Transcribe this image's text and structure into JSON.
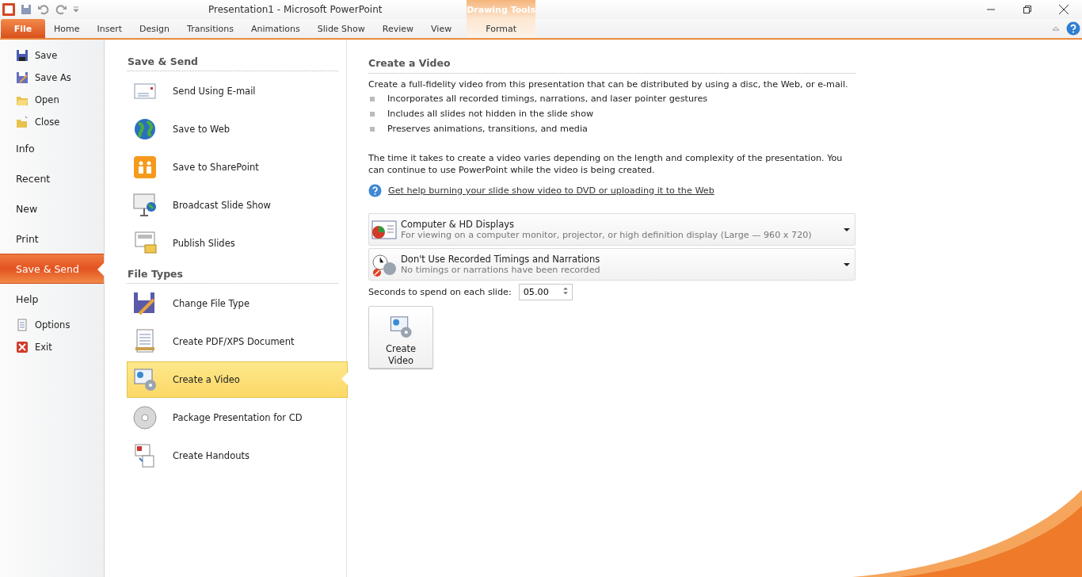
{
  "window": {
    "title": "Presentation1  -  Microsoft PowerPoint"
  },
  "ribbon_tabs": [
    {
      "label": "File",
      "selected": true
    },
    {
      "label": "Home",
      "selected": false
    },
    {
      "label": "Insert",
      "selected": false
    },
    {
      "label": "Design",
      "selected": false
    },
    {
      "label": "Transitions",
      "selected": false
    },
    {
      "label": "Animations",
      "selected": false
    },
    {
      "label": "Slide Show",
      "selected": false
    },
    {
      "label": "Review",
      "selected": false
    },
    {
      "label": "View",
      "selected": false
    }
  ],
  "contextual_tab": {
    "group": "Drawing Tools",
    "label": "Format"
  },
  "nav": [
    {
      "kind": "command",
      "label": "Save",
      "selected": false
    },
    {
      "kind": "command",
      "label": "Save As",
      "selected": false
    },
    {
      "kind": "command",
      "label": "Open",
      "selected": false
    },
    {
      "kind": "command",
      "label": "Close",
      "selected": false
    },
    {
      "kind": "page",
      "label": "Info",
      "selected": false
    },
    {
      "kind": "page",
      "label": "Recent",
      "selected": false
    },
    {
      "kind": "page",
      "label": "New",
      "selected": false
    },
    {
      "kind": "page",
      "label": "Print",
      "selected": false
    },
    {
      "kind": "page",
      "label": "Save & Send",
      "selected": true
    },
    {
      "kind": "page",
      "label": "Help",
      "selected": false
    },
    {
      "kind": "command",
      "label": "Options",
      "selected": false
    },
    {
      "kind": "command",
      "label": "Exit",
      "selected": false
    }
  ],
  "sections": [
    {
      "title": "Save & Send",
      "items": [
        {
          "label": "Send Using E-mail",
          "selected": false
        },
        {
          "label": "Save to Web",
          "selected": false
        },
        {
          "label": "Save to SharePoint",
          "selected": false
        },
        {
          "label": "Broadcast Slide Show",
          "selected": false
        },
        {
          "label": "Publish Slides",
          "selected": false
        }
      ]
    },
    {
      "title": "File Types",
      "items": [
        {
          "label": "Change File Type",
          "selected": false
        },
        {
          "label": "Create PDF/XPS Document",
          "selected": false
        },
        {
          "label": "Create a Video",
          "selected": true
        },
        {
          "label": "Package Presentation for CD",
          "selected": false
        },
        {
          "label": "Create Handouts",
          "selected": false
        }
      ]
    }
  ],
  "detail": {
    "title": "Create a Video",
    "intro": "Create a full-fidelity video from this presentation that can be distributed by using a disc, the Web, or e-mail.",
    "bullets": [
      "Incorporates all recorded timings, narrations, and laser pointer gestures",
      "Includes all slides not hidden in the slide show",
      "Preserves animations, transitions, and media"
    ],
    "note": "The time it takes to create a video varies depending on the length and complexity of the presentation. You can continue to use PowerPoint while the video is being created.",
    "help_link": "Get help burning your slide show video to DVD or uploading it to the Web",
    "dropdowns": [
      {
        "title": "Computer & HD Displays",
        "subtitle": "For viewing on a computer monitor, projector, or high definition display  (Large — 960 x 720)"
      },
      {
        "title": "Don't Use Recorded Timings and Narrations",
        "subtitle": "No timings or narrations have been recorded"
      }
    ],
    "seconds_label": "Seconds to spend on each slide:",
    "seconds_value": "05.00",
    "button": "Create Video"
  }
}
